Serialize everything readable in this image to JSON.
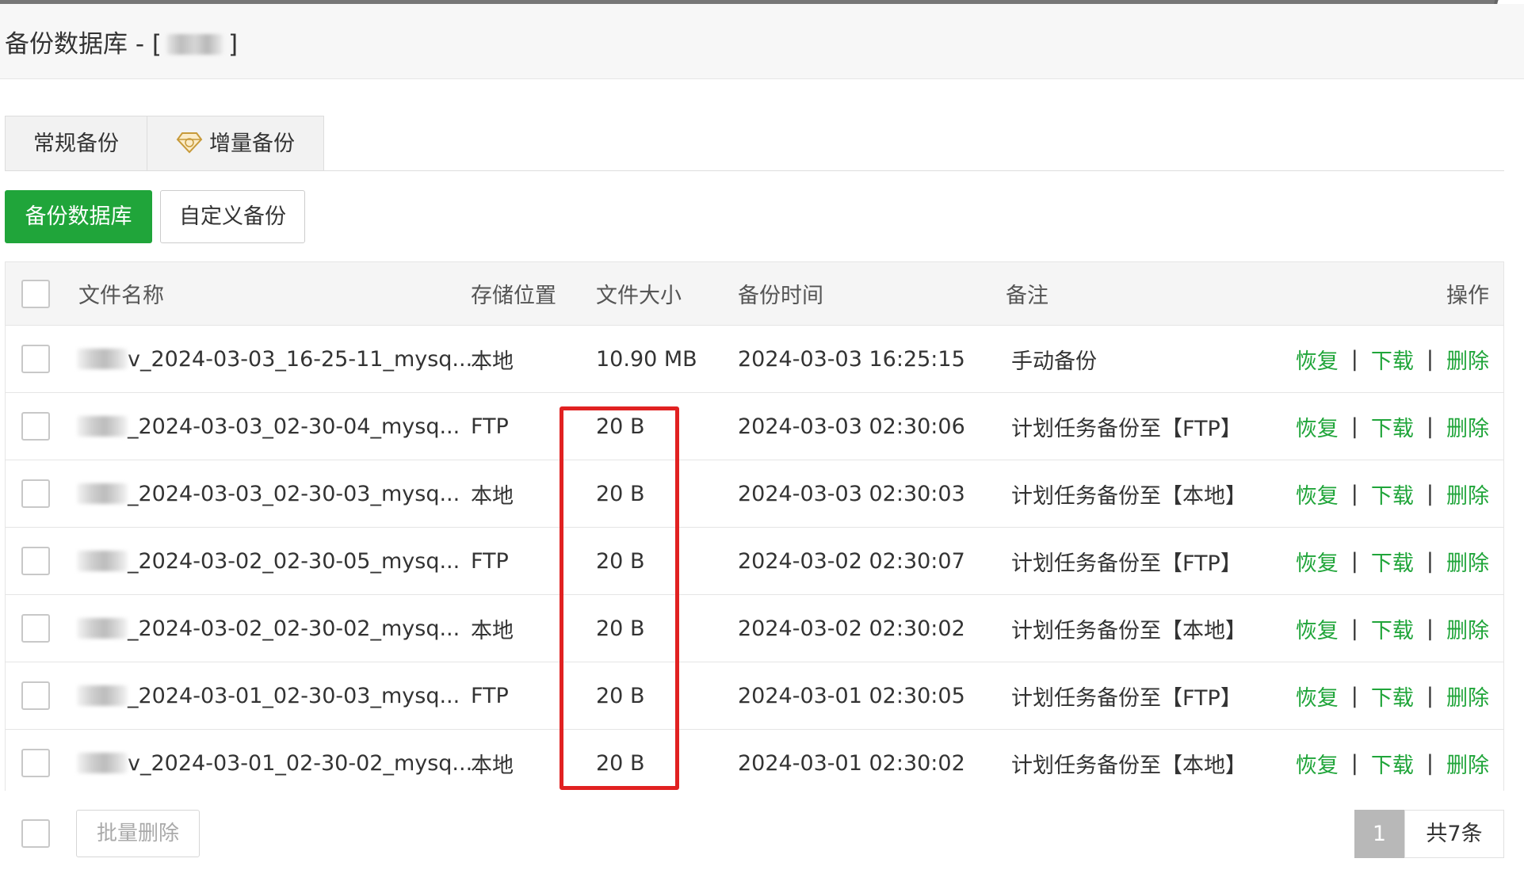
{
  "window": {
    "title_prefix": "备份数据库 - [",
    "title_suffix": "]"
  },
  "tabs": [
    {
      "label": "常规备份",
      "active": true
    },
    {
      "label": "增量备份",
      "icon": "gem-icon",
      "active": false
    }
  ],
  "toolbar": {
    "backup_db_label": "备份数据库",
    "custom_backup_label": "自定义备份"
  },
  "table": {
    "headers": {
      "name": "文件名称",
      "storage": "存储位置",
      "size": "文件大小",
      "time": "备份时间",
      "note": "备注",
      "ops": "操作"
    },
    "rows": [
      {
        "name": "_2024-03-03_16-25-11_mysq...",
        "name_prefix_visible": "v",
        "storage": "本地",
        "size": "10.90 MB",
        "time": "2024-03-03 16:25:15",
        "note": "手动备份"
      },
      {
        "name": "_2024-03-03_02-30-04_mysq...",
        "name_prefix_visible": "",
        "storage": "FTP",
        "size": "20 B",
        "time": "2024-03-03 02:30:06",
        "note": "计划任务备份至【FTP】"
      },
      {
        "name": "_2024-03-03_02-30-03_mysq...",
        "name_prefix_visible": "",
        "storage": "本地",
        "size": "20 B",
        "time": "2024-03-03 02:30:03",
        "note": "计划任务备份至【本地】"
      },
      {
        "name": "_2024-03-02_02-30-05_mysq...",
        "name_prefix_visible": "",
        "storage": "FTP",
        "size": "20 B",
        "time": "2024-03-02 02:30:07",
        "note": "计划任务备份至【FTP】"
      },
      {
        "name": "_2024-03-02_02-30-02_mysq...",
        "name_prefix_visible": "",
        "storage": "本地",
        "size": "20 B",
        "time": "2024-03-02 02:30:02",
        "note": "计划任务备份至【本地】"
      },
      {
        "name": "_2024-03-01_02-30-03_mysq...",
        "name_prefix_visible": "",
        "storage": "FTP",
        "size": "20 B",
        "time": "2024-03-01 02:30:05",
        "note": "计划任务备份至【FTP】"
      },
      {
        "name": "_2024-03-01_02-30-02_mysq...",
        "name_prefix_visible": "v",
        "storage": "本地",
        "size": "20 B",
        "time": "2024-03-01 02:30:02",
        "note": "计划任务备份至【本地】"
      }
    ],
    "ops": {
      "restore": "恢复",
      "download": "下载",
      "delete": "删除",
      "separator": "|"
    }
  },
  "footer": {
    "batch_delete_label": "批量删除",
    "current_page": "1",
    "total_label": "共7条"
  },
  "colors": {
    "accent_green": "#20a53a",
    "highlight_red": "#e12121"
  }
}
